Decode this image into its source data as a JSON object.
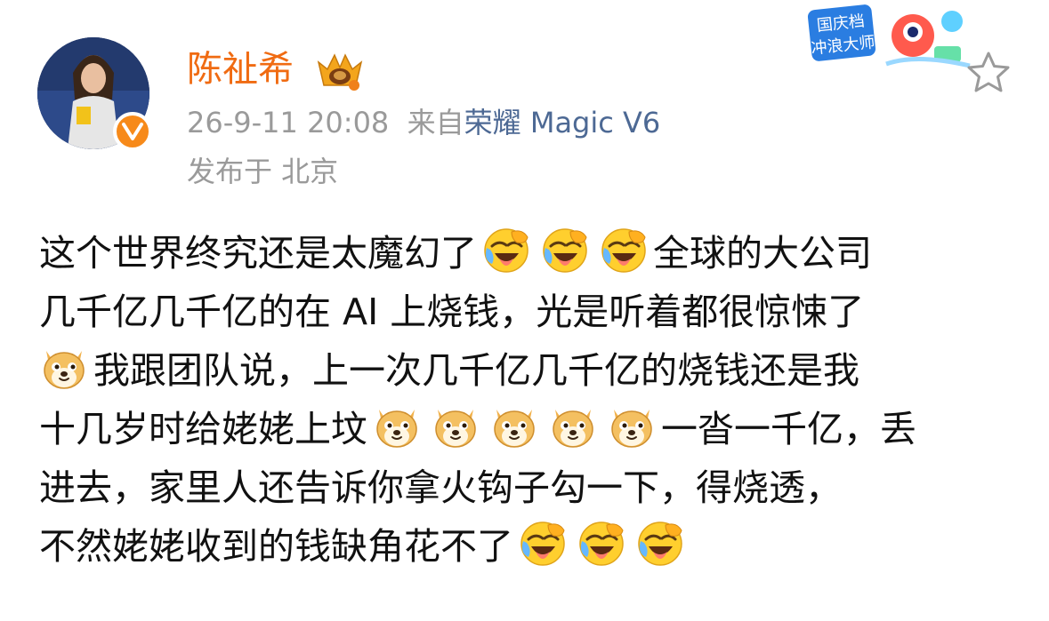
{
  "user": {
    "name": "陈祉希"
  },
  "post_meta": {
    "timestamp": "26-9-11 20:08",
    "source_prefix": "来自",
    "device_brand": "荣耀",
    "device_model": "Magic V6",
    "location": "发布于 北京"
  },
  "badge": {
    "line1": "国庆档",
    "line2": "冲浪大师"
  },
  "post": {
    "line1_text": "这个世界终究还是太魔幻了",
    "line1_tail": "全球的大公司",
    "line2_text": "几千亿几千亿的在 AI 上烧钱，光是听着都很惊悚了",
    "line3_text": "我跟团队说，上一次几千亿几千亿的烧钱还是我",
    "line4_text": "十几岁时给姥姥上坟",
    "line4_tail": "一沓一千亿，丢",
    "line5_text": "进去，家里人还告诉你拿火钩子勾一下，得烧透，",
    "line6_text": "不然姥姥收到的钱缺角花不了"
  },
  "colors": {
    "username": "#f06b12",
    "meta_gray": "#9a9a9a",
    "device_link": "#4d6994",
    "text": "#111111",
    "verified": "#f78a1a"
  },
  "icons": {
    "verified": "verified-v-icon",
    "crown": "crown-badge-icon",
    "star": "star-icon",
    "laugh_cry": "laugh-cry-emoji",
    "doge": "doge-emoji"
  }
}
